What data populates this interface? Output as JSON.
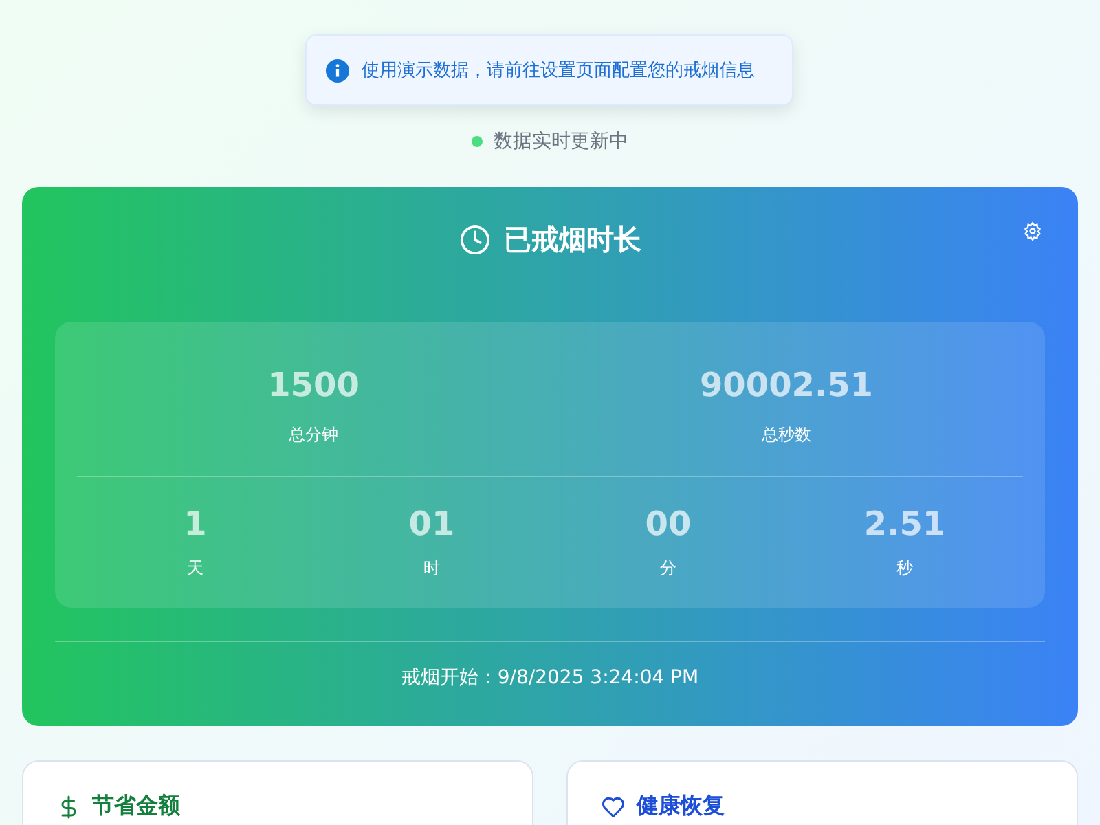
{
  "toast": {
    "message": "使用演示数据，请前往设置页面配置您的戒烟信息"
  },
  "status": {
    "text": "数据实时更新中",
    "live": true
  },
  "duration_card": {
    "title": "已戒烟时长",
    "totals": [
      {
        "value": "1500",
        "label": "总分钟"
      },
      {
        "value": "90002.51",
        "label": "总秒数"
      }
    ],
    "parts": [
      {
        "value": "1",
        "label": "天"
      },
      {
        "value": "01",
        "label": "时"
      },
      {
        "value": "00",
        "label": "分"
      },
      {
        "value": "2.51",
        "label": "秒"
      }
    ],
    "start": "戒烟开始：9/8/2025 3:24:04 PM"
  },
  "cards": [
    {
      "kind": "money",
      "title": "节省金额"
    },
    {
      "kind": "health",
      "title": "健康恢复"
    }
  ]
}
